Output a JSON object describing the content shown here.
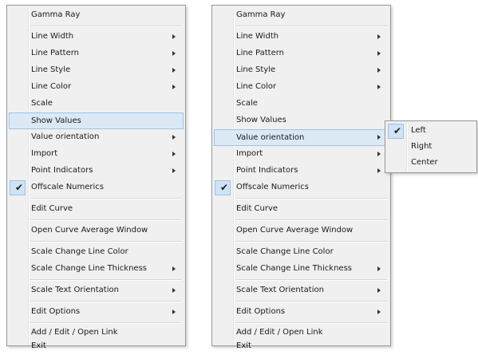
{
  "menu1": {
    "items": [
      {
        "label": "Gamma Ray"
      },
      {
        "label": "Line Width",
        "submenu": true
      },
      {
        "label": "Line Pattern",
        "submenu": true
      },
      {
        "label": "Line Style",
        "submenu": true
      },
      {
        "label": "Line Color",
        "submenu": true
      },
      {
        "label": "Scale"
      },
      {
        "label": "Show Values",
        "highlighted": true
      },
      {
        "label": "Value orientation",
        "submenu": true
      },
      {
        "label": "Import",
        "submenu": true
      },
      {
        "label": "Point Indicators",
        "submenu": true
      },
      {
        "label": "Offscale Numerics",
        "checked": true
      },
      {
        "label": "Edit Curve"
      },
      {
        "label": "Open Curve Average Window"
      },
      {
        "label": "Scale Change Line Color"
      },
      {
        "label": "Scale Change Line Thickness",
        "submenu": true
      },
      {
        "label": "Scale Text Orientation",
        "submenu": true
      },
      {
        "label": "Edit Options",
        "submenu": true
      },
      {
        "label": "Add / Edit / Open Link"
      },
      {
        "label": "Exit"
      }
    ]
  },
  "menu2": {
    "items": [
      {
        "label": "Gamma Ray"
      },
      {
        "label": "Line Width",
        "submenu": true
      },
      {
        "label": "Line Pattern",
        "submenu": true
      },
      {
        "label": "Line Style",
        "submenu": true
      },
      {
        "label": "Line Color",
        "submenu": true
      },
      {
        "label": "Scale"
      },
      {
        "label": "Show Values"
      },
      {
        "label": "Value orientation",
        "submenu": true,
        "highlighted": true
      },
      {
        "label": "Import",
        "submenu": true
      },
      {
        "label": "Point Indicators",
        "submenu": true
      },
      {
        "label": "Offscale Numerics",
        "checked": true
      },
      {
        "label": "Edit Curve"
      },
      {
        "label": "Open Curve Average Window"
      },
      {
        "label": "Scale Change Line Color"
      },
      {
        "label": "Scale Change Line Thickness",
        "submenu": true
      },
      {
        "label": "Scale Text Orientation",
        "submenu": true
      },
      {
        "label": "Edit Options",
        "submenu": true
      },
      {
        "label": "Add / Edit / Open Link"
      },
      {
        "label": "Exit"
      }
    ]
  },
  "submenu": {
    "items": [
      {
        "label": "Left",
        "checked": true
      },
      {
        "label": "Right"
      },
      {
        "label": "Center"
      }
    ]
  },
  "icons": {
    "check": "check-icon",
    "arrow": "chevron-right-icon"
  },
  "colors": {
    "menu_bg": "#f0f0f0",
    "highlight": "#dbe9f7",
    "highlight_border": "#9cc3ea"
  }
}
